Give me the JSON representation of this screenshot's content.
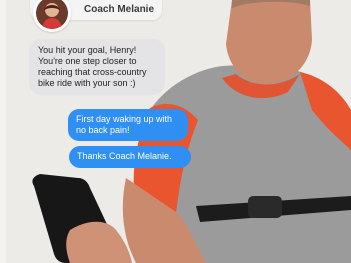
{
  "coach": {
    "name": "Coach Melanie"
  },
  "messages": [
    {
      "direction": "incoming",
      "text": "You hit your goal, Henry! You're one step closer to reaching that cross-country bike ride with your son :)"
    },
    {
      "direction": "outgoing",
      "text": "First day waking up with no back pain!"
    },
    {
      "direction": "outgoing",
      "text": "Thanks Coach Melanie."
    }
  ],
  "colors": {
    "outgoing_bubble": "#2f8ff2",
    "incoming_bubble": "#e4e4e6",
    "shirt_sleeve": "#e8552e",
    "shirt_body": "#9a9a9a"
  }
}
